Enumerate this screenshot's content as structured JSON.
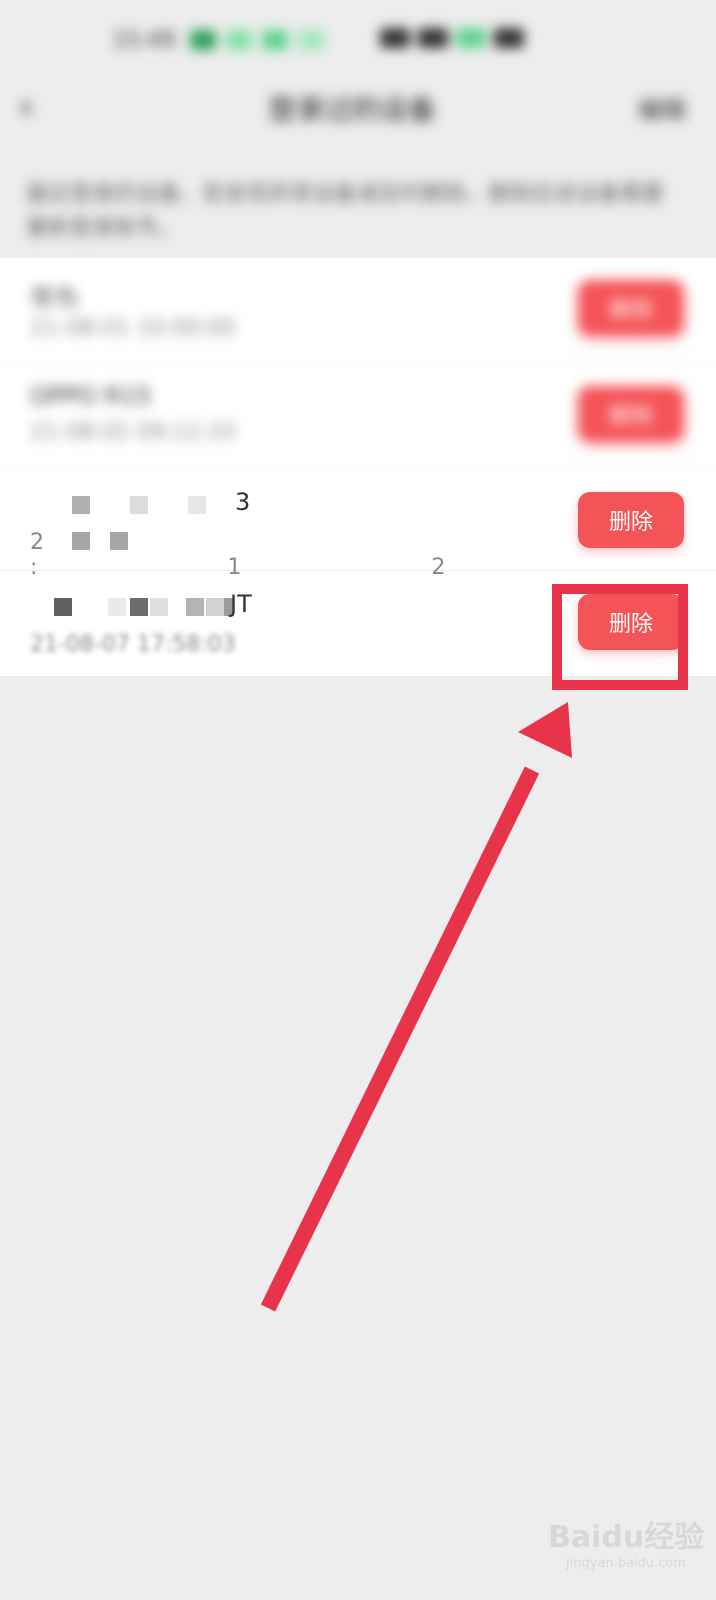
{
  "status_bar": {
    "time": "15:49"
  },
  "nav": {
    "back_icon": "chevron-left-icon",
    "title": "登录过的设备",
    "action": "编辑"
  },
  "hint": "最近登录的设备，若发现异常设备请及时删除，删除后该设备需要重新登录账号。",
  "devices": [
    {
      "name": "华为",
      "time": "21-08-01 10:00:00",
      "delete_label": "删除"
    },
    {
      "name": "OPPO R15",
      "time": "21-08-02 09:12:33",
      "delete_label": "删除"
    },
    {
      "name": "3",
      "time": "2 :12",
      "delete_label": "删除"
    },
    {
      "name": "JT",
      "time": "21-08-07 17:58:03",
      "delete_label": "删除"
    }
  ],
  "colors": {
    "accent": "#f45357",
    "annotation": "#e8344a",
    "background": "#ededed"
  },
  "watermark": {
    "brand": "Baidu经验",
    "sub": "jingyan.baidu.com"
  }
}
